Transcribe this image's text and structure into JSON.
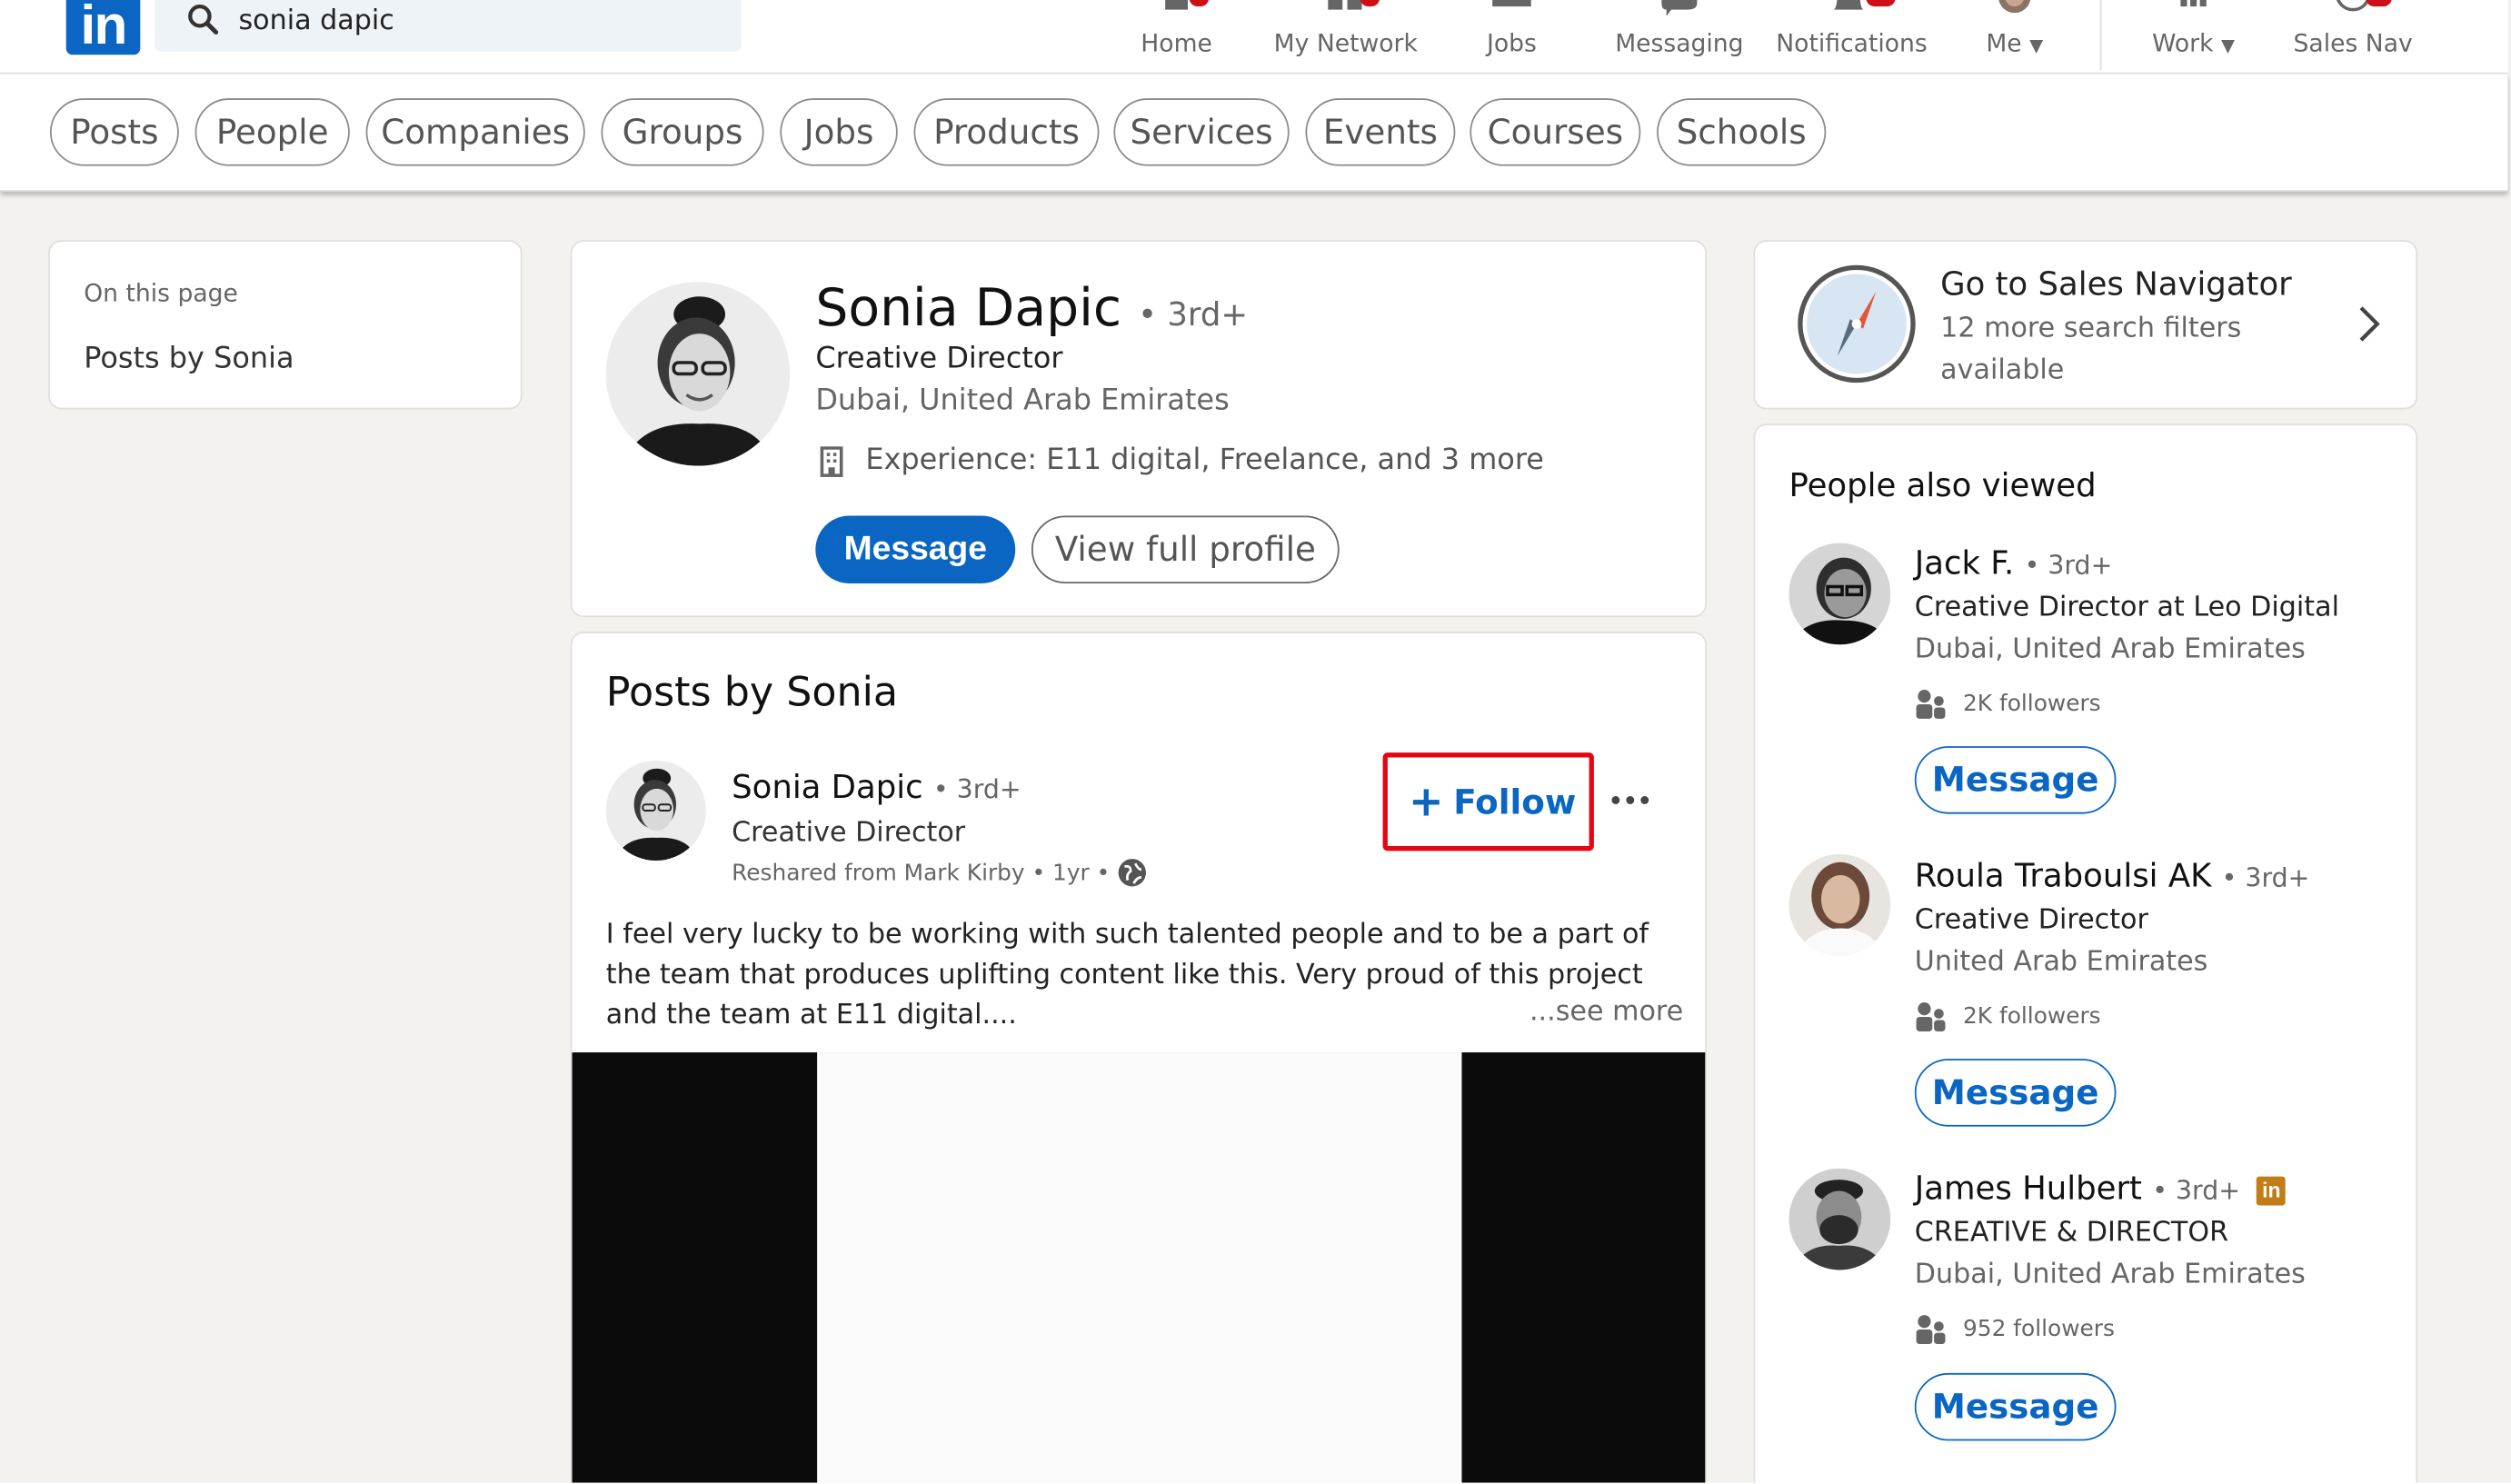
{
  "search": {
    "query": "sonia dapic"
  },
  "nav": {
    "items": [
      {
        "label": "Home",
        "icon": "home-icon"
      },
      {
        "label": "My Network",
        "icon": "network-icon"
      },
      {
        "label": "Jobs",
        "icon": "briefcase-icon"
      },
      {
        "label": "Messaging",
        "icon": "messaging-icon"
      },
      {
        "label": "Notifications",
        "icon": "bell-icon"
      },
      {
        "label": "Me",
        "icon": "avatar"
      },
      {
        "label": "Work",
        "icon": "grid-icon"
      },
      {
        "label": "Sales Nav",
        "icon": "compass-icon"
      }
    ],
    "badge_color": "#cc1016"
  },
  "filters": [
    "Posts",
    "People",
    "Companies",
    "Groups",
    "Jobs",
    "Products",
    "Services",
    "Events",
    "Courses",
    "Schools"
  ],
  "on_this_page": {
    "label": "On this page",
    "link": "Posts by Sonia"
  },
  "profile": {
    "name": "Sonia Dapic",
    "degree": "• 3rd+",
    "title": "Creative Director",
    "location": "Dubai, United Arab Emirates",
    "experience": "Experience: E11 digital, Freelance, and 3 more",
    "message_label": "Message",
    "view_profile_label": "View full profile"
  },
  "posts": {
    "section_title": "Posts by Sonia",
    "author": "Sonia Dapic",
    "degree": "• 3rd+",
    "headline": "Creative Director",
    "meta": "Reshared from Mark Kirby • 1yr •",
    "follow_label": "Follow",
    "body": "I feel very lucky to be working with such talented people and to be a part of the team that produces uplifting content like this. Very proud of this project and the team at E11 digital....",
    "see_more": "...see more"
  },
  "sales_navigator": {
    "title": "Go to Sales Navigator",
    "subtitle": "12 more search filters available"
  },
  "people_also_viewed": {
    "title": "People also viewed",
    "people": [
      {
        "name": "Jack F.",
        "degree": "• 3rd+",
        "headline": "Creative Director at Leo Digital",
        "location": "Dubai, United Arab Emirates",
        "followers": "2K followers",
        "button": "Message",
        "premium": false
      },
      {
        "name": "Roula Traboulsi AK",
        "degree": "• 3rd+",
        "headline": "Creative Director",
        "location": "United Arab Emirates",
        "followers": "2K followers",
        "button": "Message",
        "premium": false
      },
      {
        "name": "James Hulbert",
        "degree": "• 3rd+",
        "headline": "CREATIVE & DIRECTOR",
        "location": "Dubai, United Arab Emirates",
        "followers": "952 followers",
        "button": "Message",
        "premium": true,
        "premium_badge": "in"
      }
    ]
  },
  "colors": {
    "brand": "#0a66c2",
    "highlight_box": "#e30613",
    "background": "#f3f2ef"
  }
}
